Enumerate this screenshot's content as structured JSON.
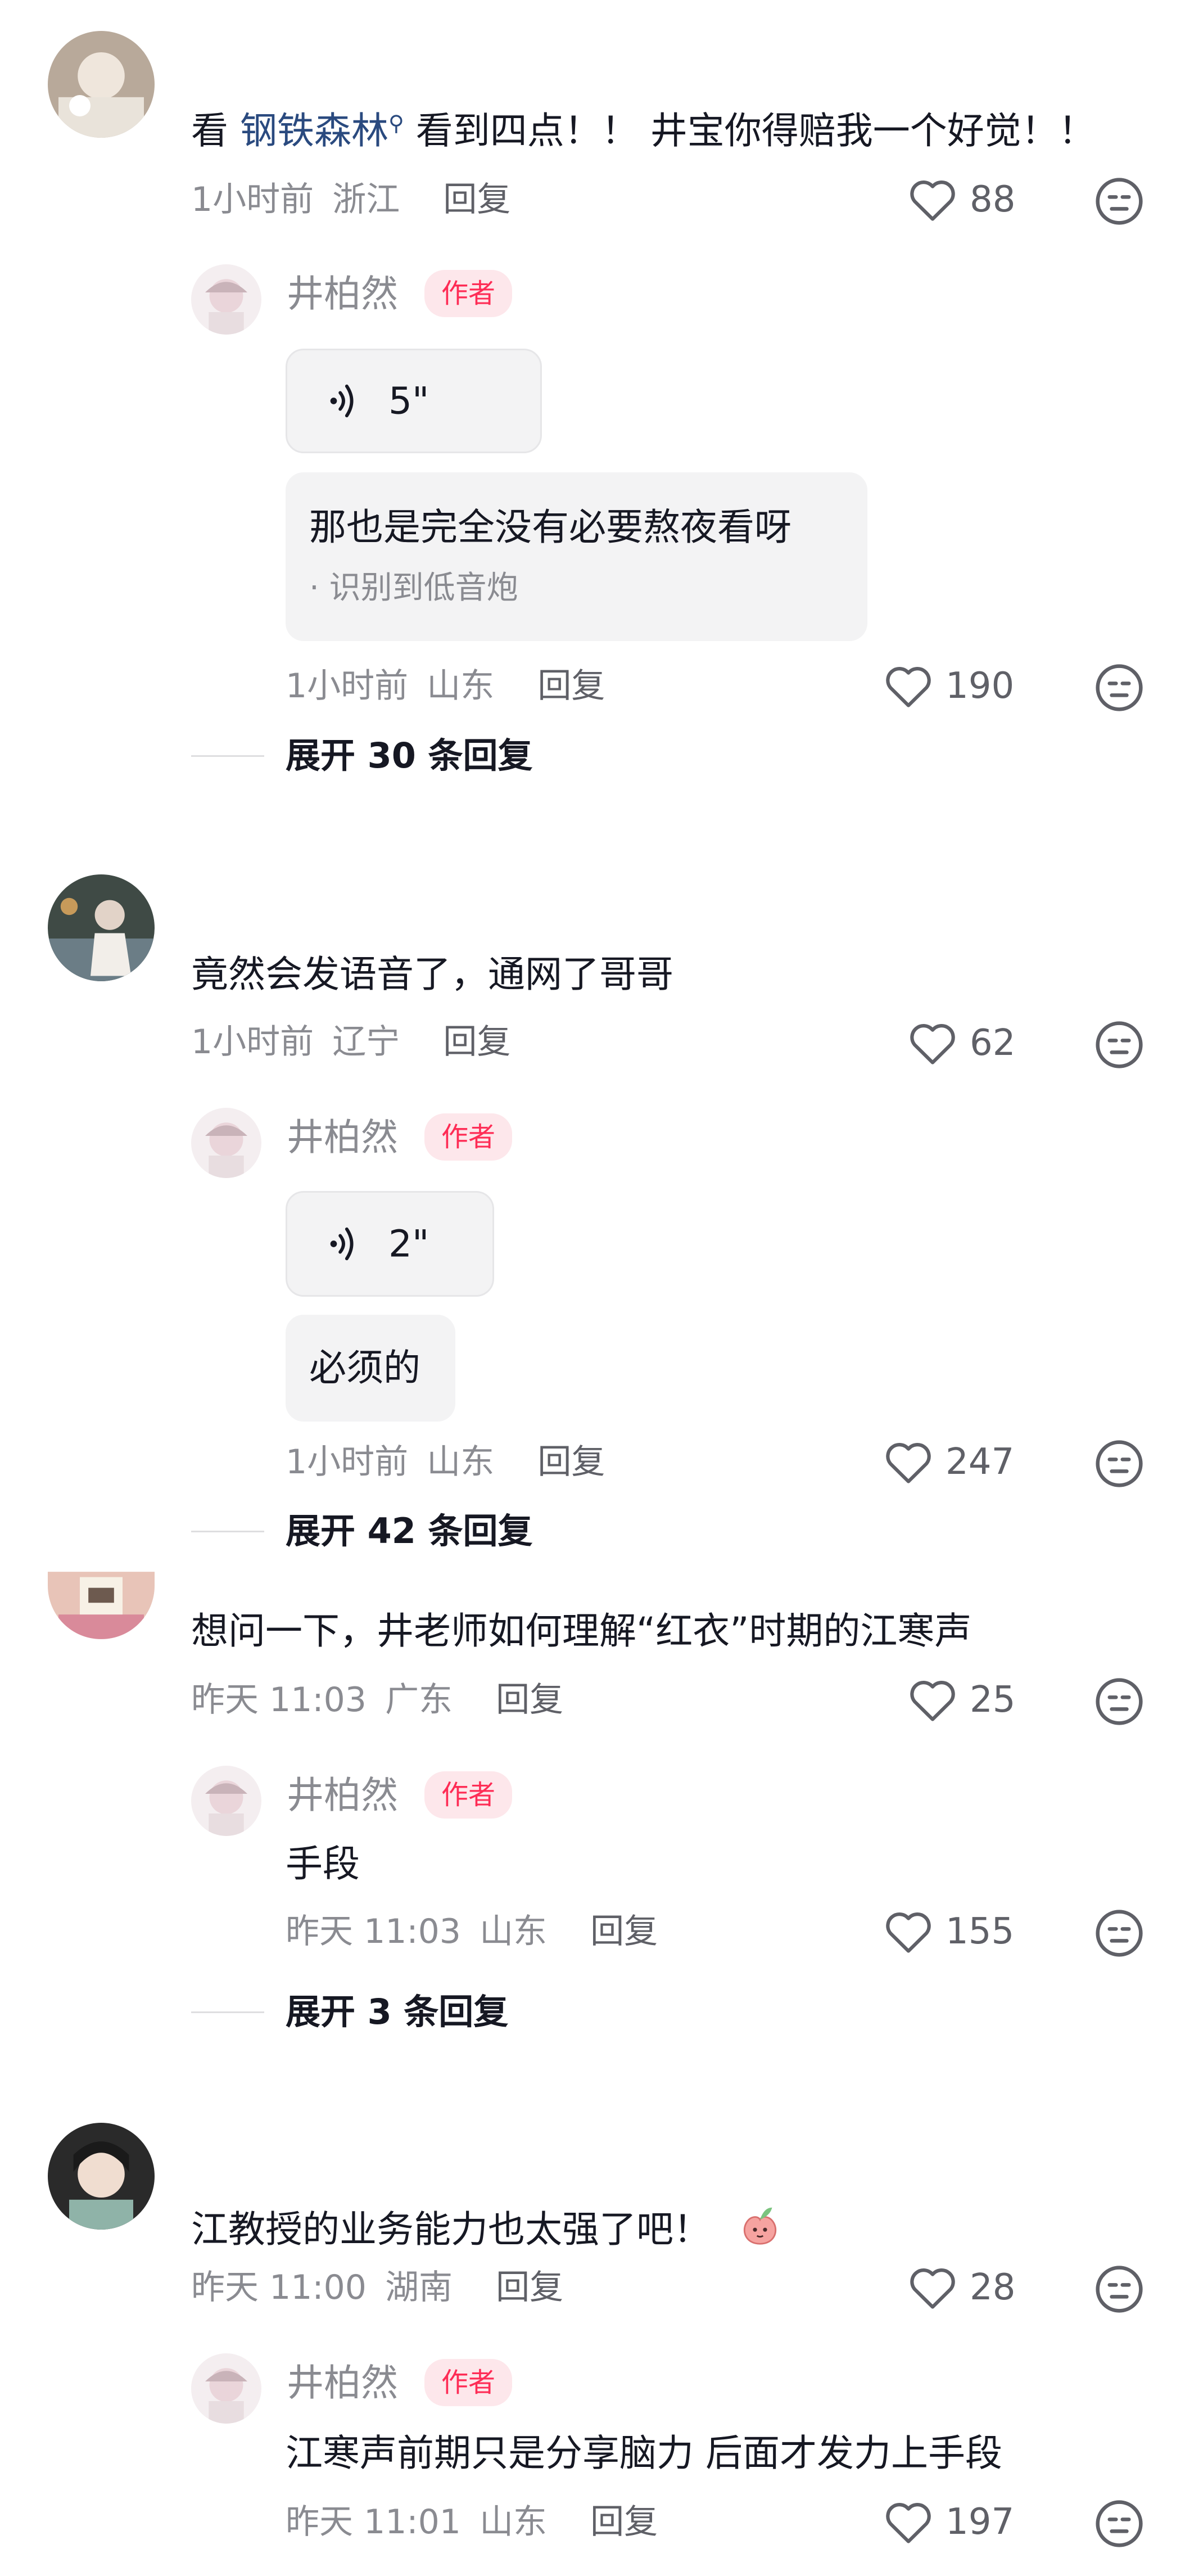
{
  "comments": [
    {
      "mention": "钢铁森林",
      "text_before": "看 ",
      "text_after": " 看到四点！！ 井宝你得赔我一个好觉！！",
      "time": "1小时前",
      "location": "浙江",
      "reply_label": "回复",
      "likes": "88",
      "replies": [
        {
          "author": "井柏然",
          "badge": "作者",
          "voice_duration": "5\"",
          "transcript": "那也是完全没有必要熬夜看呀",
          "transcript_note": "· 识别到低音炮",
          "time": "1小时前",
          "location": "山东",
          "reply_label": "回复",
          "likes": "190"
        }
      ],
      "expand_label": "展开 30 条回复"
    },
    {
      "text": "竟然会发语音了，通网了哥哥",
      "time": "1小时前",
      "location": "辽宁",
      "reply_label": "回复",
      "likes": "62",
      "replies": [
        {
          "author": "井柏然",
          "badge": "作者",
          "voice_duration": "2\"",
          "transcript": "必须的",
          "time": "1小时前",
          "location": "山东",
          "reply_label": "回复",
          "likes": "247"
        }
      ],
      "expand_label": "展开 42 条回复"
    },
    {
      "text": "想问一下，井老师如何理解“红衣”时期的江寒声",
      "time": "昨天 11:03",
      "location": "广东",
      "reply_label": "回复",
      "likes": "25",
      "replies": [
        {
          "author": "井柏然",
          "badge": "作者",
          "text": "手段",
          "time": "昨天 11:03",
          "location": "山东",
          "reply_label": "回复",
          "likes": "155"
        }
      ],
      "expand_label": "展开 3 条回复"
    },
    {
      "text": "江教授的业务能力也太强了吧！",
      "time": "昨天 11:00",
      "location": "湖南",
      "reply_label": "回复",
      "likes": "28",
      "replies": [
        {
          "author": "井柏然",
          "badge": "作者",
          "text": "江寒声前期只是分享脑力 后面才发力上手段",
          "time": "昨天 11:01",
          "location": "山东",
          "reply_label": "回复",
          "likes": "197"
        }
      ]
    }
  ],
  "icons": {
    "like": "heart-outline-icon",
    "dislike": "neutral-face-icon",
    "voice": "sound-wave-icon",
    "search_hint": "search-icon",
    "sticker": "peach-sticker-icon"
  },
  "colors": {
    "mention": "#2a4a7f",
    "badge_text": "#fe2c55",
    "badge_bg": "#fde7eb",
    "meta": "#8a8b91"
  }
}
